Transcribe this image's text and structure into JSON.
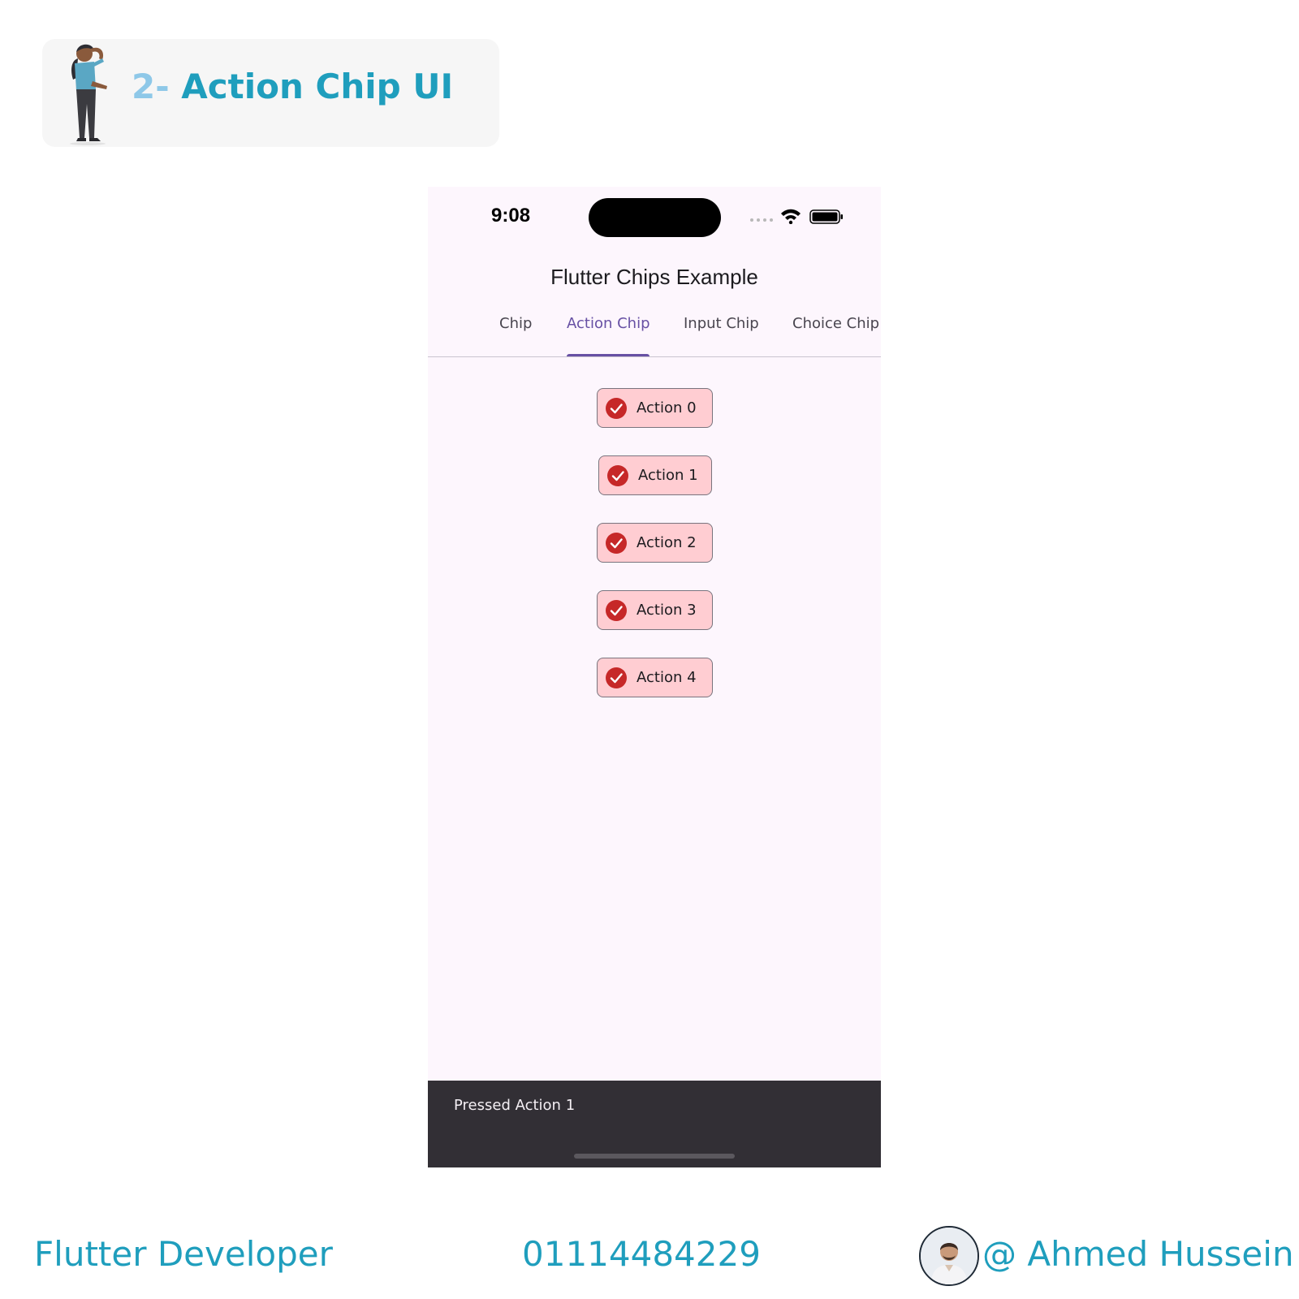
{
  "header": {
    "title_number": "2-",
    "title_text": "Action Chip UI"
  },
  "phone": {
    "status_time": "9:08",
    "app_title": "Flutter Chips Example",
    "tabs": [
      {
        "label": "Chip",
        "active": false
      },
      {
        "label": "Action Chip",
        "active": true
      },
      {
        "label": "Input Chip",
        "active": false
      },
      {
        "label": "Choice Chip",
        "active": false
      }
    ],
    "chips": [
      {
        "label": "Action 0",
        "icon": "check-circle-icon"
      },
      {
        "label": "Action 1",
        "icon": "check-circle-icon"
      },
      {
        "label": "Action 2",
        "icon": "check-circle-icon"
      },
      {
        "label": "Action 3",
        "icon": "check-circle-icon"
      },
      {
        "label": "Action 4",
        "icon": "check-circle-icon"
      }
    ],
    "snackbar_text": "Pressed Action 1"
  },
  "footer": {
    "role": "Flutter Developer",
    "phone_number": "01114484229",
    "handle": "@ Ahmed Hussein"
  },
  "colors": {
    "brand_teal": "#1f9ebd",
    "tab_active": "#6750a4",
    "chip_bg": "#ffcdd2",
    "chip_icon": "#c62828",
    "snackbar_bg": "#322f35"
  }
}
